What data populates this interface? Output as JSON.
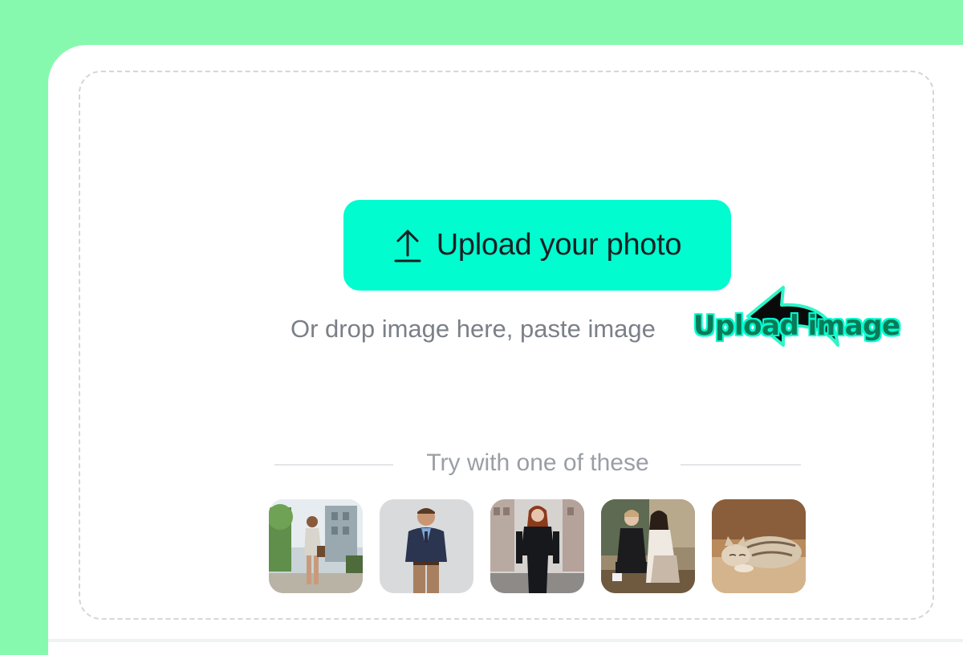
{
  "upload": {
    "button_label": "Upload your photo",
    "icon": "upload-arrow-icon",
    "hint": "Or drop image here, paste image"
  },
  "annotation": {
    "label": "Upload image",
    "icon": "curved-arrow-icon"
  },
  "samples": {
    "heading": "Try with one of these",
    "items": [
      "woman-walking-street-photo",
      "man-in-blazer-photo",
      "woman-in-black-suit-photo",
      "couple-sitting-photo",
      "sleeping-cat-photo"
    ]
  },
  "colors": {
    "background": "#87f9ae",
    "accent": "#00fccf",
    "card": "#ffffff",
    "dashed_border": "#d4d6d9",
    "hint_text": "#7b8088",
    "annotation_text": "#0c7a57"
  }
}
